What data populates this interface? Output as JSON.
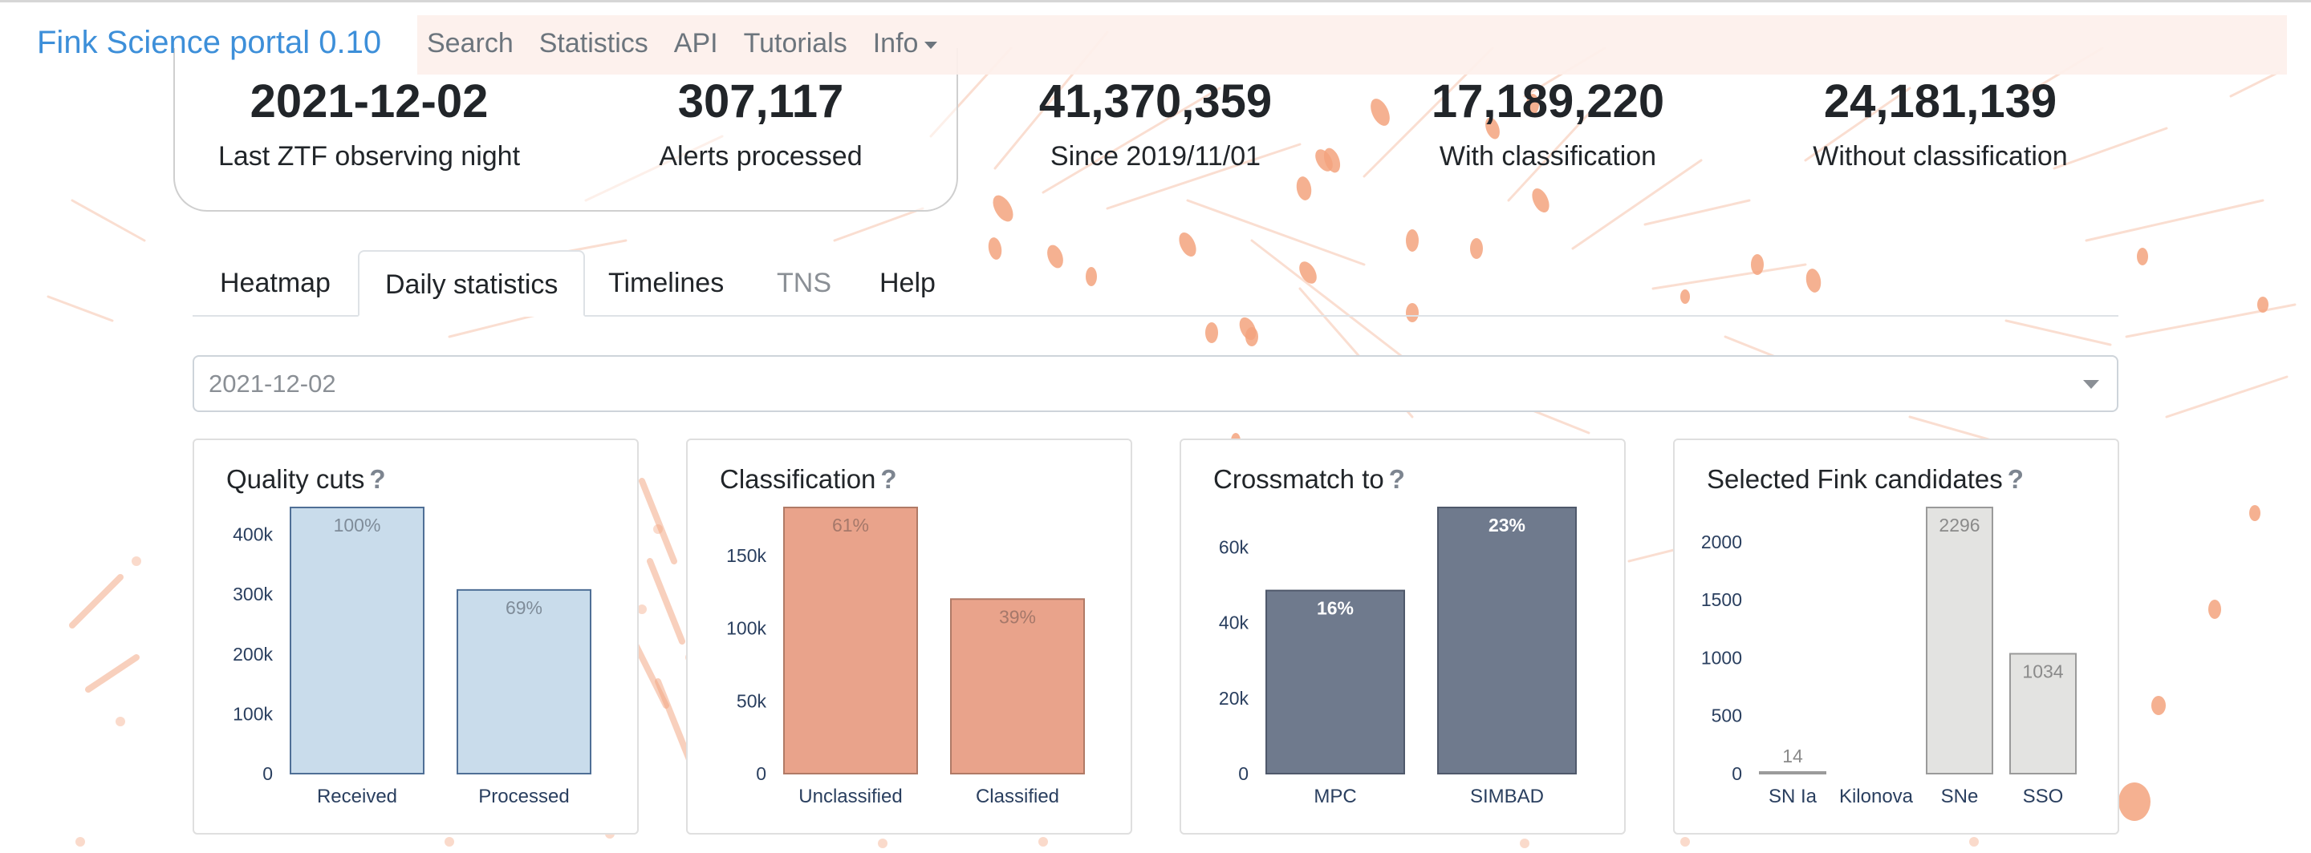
{
  "navbar": {
    "brand": "Fink Science portal 0.10",
    "links": [
      "Search",
      "Statistics",
      "API",
      "Tutorials",
      "Info"
    ]
  },
  "stats": [
    {
      "value": "2021-12-02",
      "label": "Last ZTF observing night"
    },
    {
      "value": "307,117",
      "label": "Alerts processed"
    },
    {
      "value": "41,370,359",
      "label": "Since 2019/11/01"
    },
    {
      "value": "17,189,220",
      "label": "With classification"
    },
    {
      "value": "24,181,139",
      "label": "Without classification"
    }
  ],
  "tabs": [
    "Heatmap",
    "Daily statistics",
    "Timelines",
    "TNS",
    "Help"
  ],
  "active_tab": "Daily statistics",
  "date_select": {
    "value": "2021-12-02"
  },
  "help_glyph": "?",
  "colors": {
    "brand": "#3d8fd9",
    "quality": "#c9dceb",
    "quality_edge": "#4f6f96",
    "classification": "#e9a38b",
    "classification_edge": "#b07a66",
    "crossmatch": "#6f7a8d",
    "crossmatch_edge": "#4f596b",
    "candidates": "#e3e3e1",
    "candidates_edge": "#9a9a9a",
    "background_art": "#f3a37e"
  },
  "chart_data": [
    {
      "type": "bar",
      "title": "Quality cuts",
      "categories": [
        "Received",
        "Processed"
      ],
      "values": [
        445000,
        307117
      ],
      "bar_labels": [
        "100%",
        "69%"
      ],
      "yticks": [
        0,
        100000,
        200000,
        300000,
        400000
      ],
      "ytick_labels": [
        "0",
        "100k",
        "200k",
        "300k",
        "400k"
      ],
      "ylim": [
        0,
        445000
      ],
      "grid": false
    },
    {
      "type": "bar",
      "title": "Classification",
      "categories": [
        "Unclassified",
        "Classified"
      ],
      "values": [
        183000,
        120000
      ],
      "bar_labels": [
        "61%",
        "39%"
      ],
      "yticks": [
        0,
        50000,
        100000,
        150000
      ],
      "ytick_labels": [
        "0",
        "50k",
        "100k",
        "150k"
      ],
      "ylim": [
        0,
        183000
      ],
      "grid": false
    },
    {
      "type": "bar",
      "title": "Crossmatch to",
      "categories": [
        "MPC",
        "SIMBAD"
      ],
      "values": [
        48500,
        70500
      ],
      "bar_labels": [
        "16%",
        "23%"
      ],
      "yticks": [
        0,
        20000,
        40000,
        60000
      ],
      "ytick_labels": [
        "0",
        "20k",
        "40k",
        "60k"
      ],
      "ylim": [
        0,
        70500
      ],
      "grid": false
    },
    {
      "type": "bar",
      "title": "Selected Fink candidates",
      "categories": [
        "SN Ia",
        "Kilonova",
        "SNe",
        "SSO"
      ],
      "values": [
        14,
        0,
        2296,
        1034
      ],
      "bar_labels": [
        "14",
        "",
        "2296",
        "1034"
      ],
      "yticks": [
        0,
        500,
        1000,
        1500,
        2000
      ],
      "ytick_labels": [
        "0",
        "500",
        "1000",
        "1500",
        "2000"
      ],
      "ylim": [
        0,
        2296
      ],
      "grid": false
    }
  ]
}
